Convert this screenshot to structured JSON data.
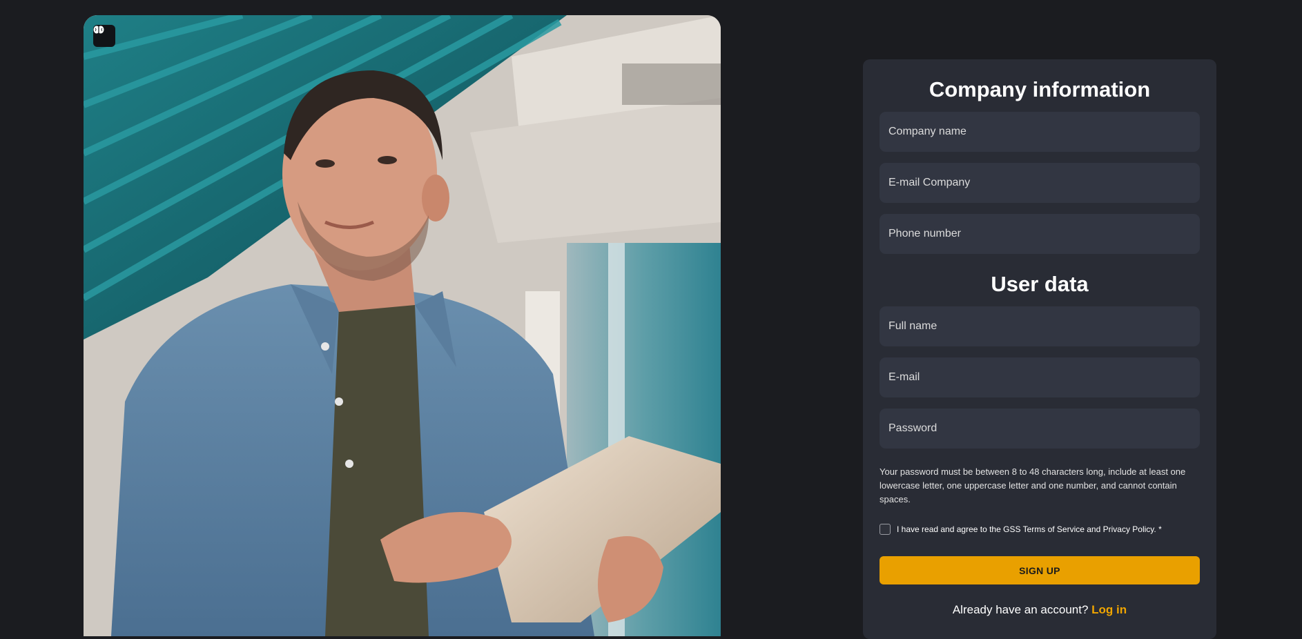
{
  "hero": {
    "logo_icon": "brain-icon"
  },
  "company_section": {
    "title": "Company information",
    "fields": {
      "company_name": "Company name",
      "company_email": "E-mail Company",
      "phone": "Phone number"
    }
  },
  "user_section": {
    "title": "User data",
    "fields": {
      "full_name": "Full name",
      "email": "E-mail",
      "password": "Password"
    }
  },
  "password_help": "Your password must be between 8 to 48 characters long, include at least one lowercase letter, one uppercase letter and one number, and cannot contain spaces.",
  "terms_label": "I have read and agree to the GSS Terms of Service and Privacy Policy. *",
  "signup_label": "SIGN UP",
  "login_prompt": "Already have an account?",
  "login_link": "Log in",
  "colors": {
    "background": "#1b1c20",
    "card": "#292c35",
    "input": "#323642",
    "accent": "#e9a000"
  }
}
